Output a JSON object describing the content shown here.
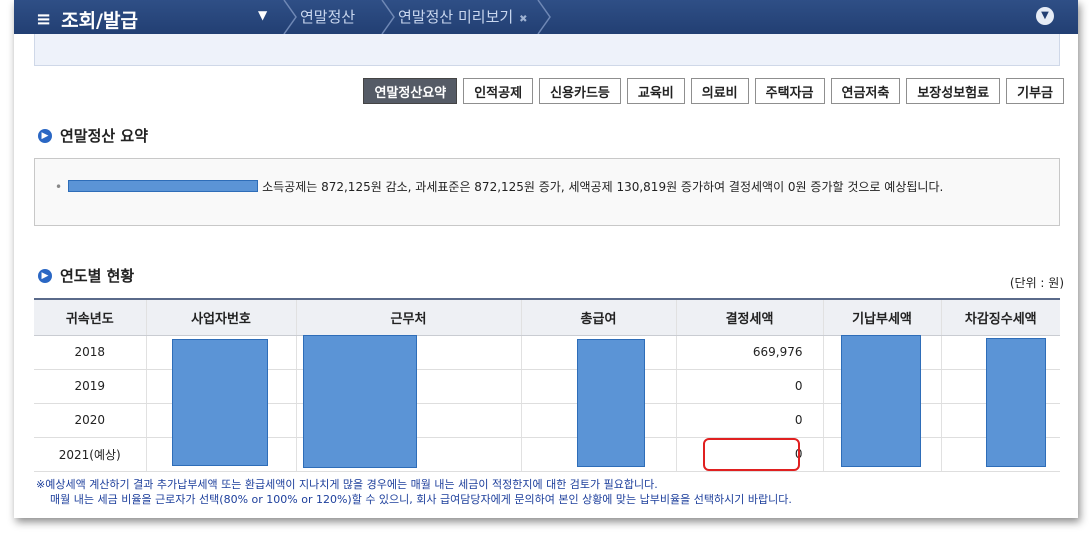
{
  "topbar": {
    "menu_label": "조회/발급",
    "breadcrumb": [
      "연말정산",
      "연말정산 미리보기"
    ]
  },
  "tabs": [
    {
      "label": "연말정산요약",
      "active": true
    },
    {
      "label": "인적공제",
      "active": false
    },
    {
      "label": "신용카드등",
      "active": false
    },
    {
      "label": "교육비",
      "active": false
    },
    {
      "label": "의료비",
      "active": false
    },
    {
      "label": "주택자금",
      "active": false
    },
    {
      "label": "연금저축",
      "active": false
    },
    {
      "label": "보장성보험료",
      "active": false
    },
    {
      "label": "기부금",
      "active": false
    }
  ],
  "summary": {
    "title": "연말정산 요약",
    "text": "소득공제는 872,125원 감소, 과세표준은 872,125원 증가, 세액공제 130,819원 증가하여 결정세액이 0원 증가할 것으로 예상됩니다."
  },
  "yearly": {
    "title": "연도별 현황",
    "unit": "(단위 : 원)",
    "columns": [
      "귀속년도",
      "사업자번호",
      "근무처",
      "총급여",
      "결정세액",
      "기납부세액",
      "차감징수세액"
    ],
    "rows": [
      {
        "year": "2018",
        "tax": "669,976"
      },
      {
        "year": "2019",
        "tax": "0"
      },
      {
        "year": "2020",
        "tax": "0"
      },
      {
        "year": "2021(예상)",
        "tax": "0"
      }
    ]
  },
  "notes": {
    "line1": "※예상세액 계산하기 결과 추가납부세액 또는 환급세액이 지나치게 많을 경우에는 매월 내는 세금이 적정한지에 대한 검토가 필요합니다.",
    "line2": "매월 내는 세금 비율을 근로자가 선택(80% or 100% or 120%)할 수 있으니, 회사 급여담당자에게 문의하여 본인 상황에 맞는 납부비율을 선택하시기 바랍니다."
  },
  "colors": {
    "topbar": "#223f73",
    "accent": "#2a67c4",
    "redaction": "#5b94d6",
    "highlight": "#e02020",
    "note_text": "#1d3f9c"
  }
}
